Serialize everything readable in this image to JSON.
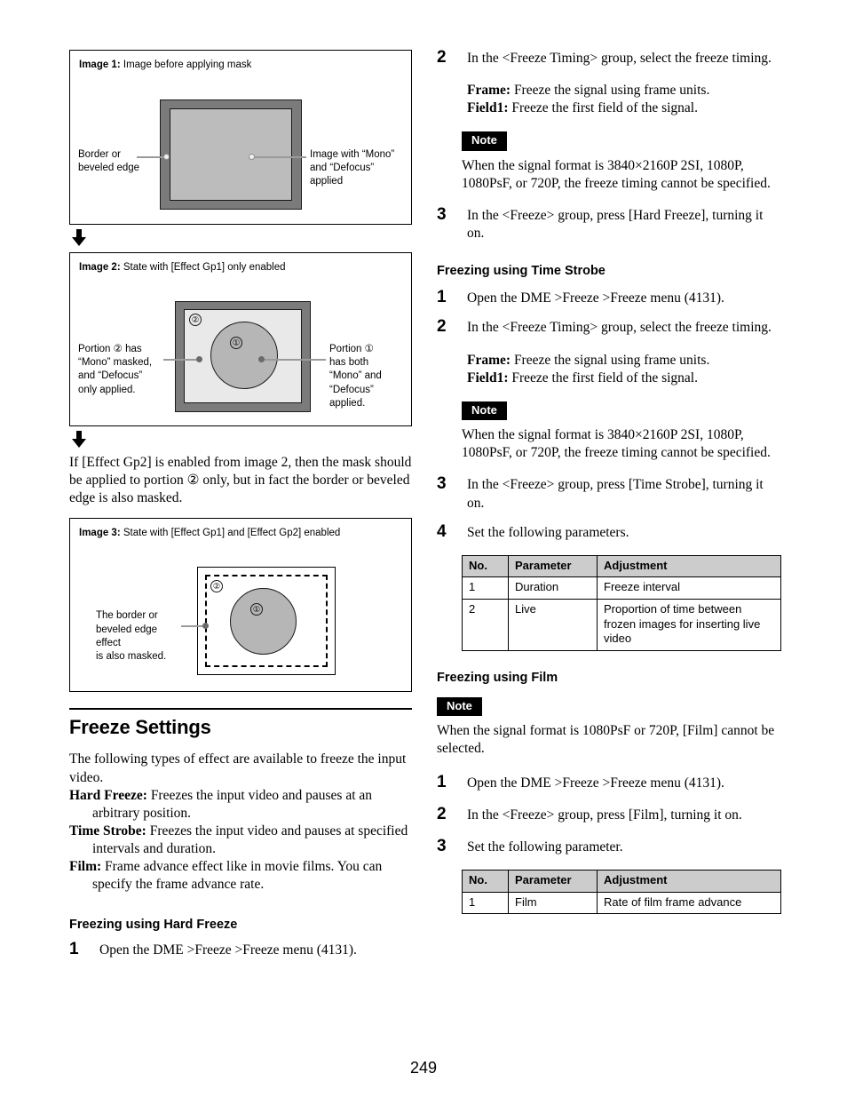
{
  "page": {
    "number": "249"
  },
  "figures": [
    {
      "id": "image-1",
      "label": "Image 1:",
      "caption": "Image before applying mask",
      "callouts": [
        {
          "name": "border-or-beveled-edge",
          "lines": [
            "Border or",
            "beveled edge"
          ]
        },
        {
          "name": "image-with-mono-and-defocus",
          "lines": [
            "Image with “Mono”",
            "and “Defocus”",
            "applied"
          ]
        }
      ]
    },
    {
      "id": "image-2",
      "label": "Image 2:",
      "caption": "State with [Effect Gp1] only enabled",
      "markers": {
        "outer": "②",
        "inner": "①"
      },
      "callouts": [
        {
          "name": "portion-2-description",
          "lines": [
            "Portion ② has",
            "“Mono” masked,",
            "and “Defocus”",
            "only applied."
          ]
        },
        {
          "name": "portion-1-description",
          "lines": [
            "Portion ①",
            "has both",
            "“Mono” and",
            "“Defocus”",
            "applied."
          ]
        }
      ]
    },
    {
      "id": "image-3",
      "label": "Image 3:",
      "caption": "State with [Effect Gp1] and [Effect Gp2] enabled",
      "markers": {
        "outer": "②",
        "inner": "①"
      },
      "callouts": [
        {
          "name": "border-beveled-edge-masked",
          "lines": [
            "The border or",
            "beveled edge effect",
            "is also masked."
          ]
        }
      ]
    }
  ],
  "interstitial_text": "If [Effect Gp2] is enabled from image 2, then the mask should be applied to portion ② only, but in fact the border or beveled edge is also masked.",
  "freeze_settings": {
    "heading": "Freeze Settings",
    "intro": "The following types of effect are available to freeze the input video.",
    "effects": [
      {
        "term": "Hard Freeze:",
        "desc": "Freezes the input video and pauses at an arbitrary position."
      },
      {
        "term": "Time Strobe:",
        "desc": "Freezes the input video and pauses at specified intervals and duration."
      },
      {
        "term": "Film:",
        "desc": "Frame advance effect like in movie films. You can specify the frame advance rate."
      }
    ]
  },
  "hard_freeze": {
    "heading": "Freezing using Hard Freeze",
    "step1_num": "1",
    "step1": "Open the DME >Freeze >Freeze menu (4131).",
    "step2_num": "2",
    "step2": "In the <Freeze Timing> group, select the freeze timing.",
    "frame_term": "Frame:",
    "frame_desc": "Freeze the signal using frame units.",
    "field1_term": "Field1:",
    "field1_desc": "Freeze the first field of the signal.",
    "note_label": "Note",
    "note_text": "When the signal format is 3840×2160P 2SI, 1080P, 1080PsF, or 720P, the freeze timing cannot be specified.",
    "step3_num": "3",
    "step3": "In the <Freeze> group, press [Hard Freeze], turning it on."
  },
  "time_strobe": {
    "heading": "Freezing using Time Strobe",
    "step1_num": "1",
    "step1": "Open the DME >Freeze >Freeze menu (4131).",
    "step2_num": "2",
    "step2": "In the <Freeze Timing> group, select the freeze timing.",
    "frame_term": "Frame:",
    "frame_desc": "Freeze the signal using frame units.",
    "field1_term": "Field1:",
    "field1_desc": "Freeze the first field of the signal.",
    "note_label": "Note",
    "note_text": "When the signal format is 3840×2160P 2SI, 1080P, 1080PsF, or 720P, the freeze timing cannot be specified.",
    "step3_num": "3",
    "step3": "In the <Freeze> group, press [Time Strobe], turning it on.",
    "step4_num": "4",
    "step4": "Set the following parameters.",
    "table": {
      "headers": [
        "No.",
        "Parameter",
        "Adjustment"
      ],
      "rows": [
        [
          "1",
          "Duration",
          "Freeze interval"
        ],
        [
          "2",
          "Live",
          "Proportion of time between frozen images for inserting live video"
        ]
      ]
    }
  },
  "film": {
    "heading": "Freezing using Film",
    "note_label": "Note",
    "note_text": "When the signal format is 1080PsF or 720P, [Film] cannot be selected.",
    "step1_num": "1",
    "step1": "Open the DME >Freeze >Freeze menu (4131).",
    "step2_num": "2",
    "step2": "In the <Freeze> group, press [Film], turning it on.",
    "step3_num": "3",
    "step3": "Set the following parameter.",
    "table": {
      "headers": [
        "No.",
        "Parameter",
        "Adjustment"
      ],
      "rows": [
        [
          "1",
          "Film",
          "Rate of film frame advance"
        ]
      ]
    }
  },
  "colors": {
    "border_band": "#7b7b7b",
    "image_fill": "#bcbcbc",
    "light_fill": "#e9e9e9",
    "circle_fill": "#b6b6b6",
    "table_header": "#cccccc",
    "note_badge": "#000000"
  }
}
